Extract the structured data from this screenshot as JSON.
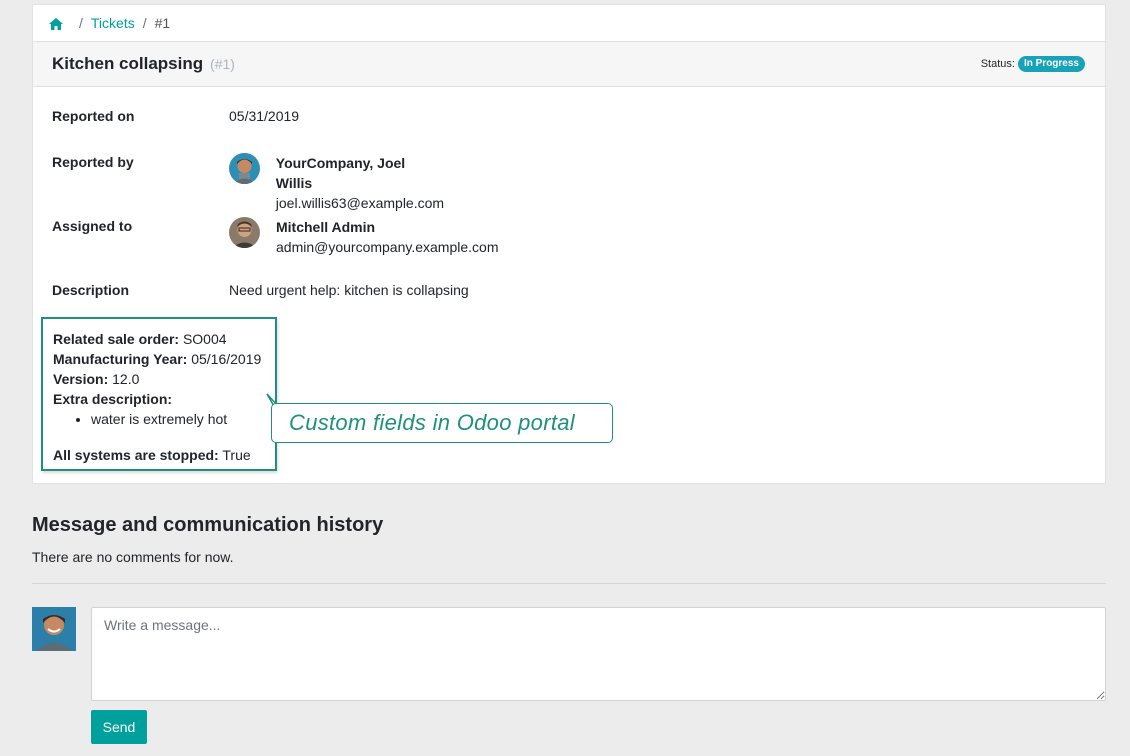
{
  "breadcrumb": {
    "home_icon": "home-icon",
    "sep": "/",
    "tickets": "Tickets",
    "current": "#1"
  },
  "ticket": {
    "title": "Kitchen collapsing",
    "ref": "(#1)",
    "status_label": "Status:",
    "status_value": "In Progress"
  },
  "fields": {
    "reported_on_label": "Reported on",
    "reported_on_value": "05/31/2019",
    "reported_by_label": "Reported by",
    "reported_by_name": "YourCompany, Joel Willis",
    "reported_by_email": "joel.willis63@example.com",
    "assigned_to_label": "Assigned to",
    "assigned_to_name": "Mitchell Admin",
    "assigned_to_email": "admin@yourcompany.example.com",
    "description_label": "Description",
    "description_value": "Need urgent help: kitchen is collapsing"
  },
  "custom_fields": {
    "sale_order_label": "Related sale order:",
    "sale_order_value": "SO004",
    "mfg_year_label": "Manufacturing Year:",
    "mfg_year_value": "05/16/2019",
    "version_label": "Version:",
    "version_value": "12.0",
    "extra_label": "Extra description:",
    "extra_items": [
      "water is extremely hot"
    ],
    "stopped_label": "All systems are stopped:",
    "stopped_value": "True"
  },
  "callout": {
    "text": "Custom fields in Odoo portal"
  },
  "history": {
    "title": "Message and communication history",
    "empty_text": "There are no comments for now."
  },
  "composer": {
    "placeholder": "Write a message...",
    "send_label": "Send"
  },
  "colors": {
    "accent": "#00a09d",
    "status_badge": "#17a2b8",
    "annotation": "#1e8f80"
  }
}
